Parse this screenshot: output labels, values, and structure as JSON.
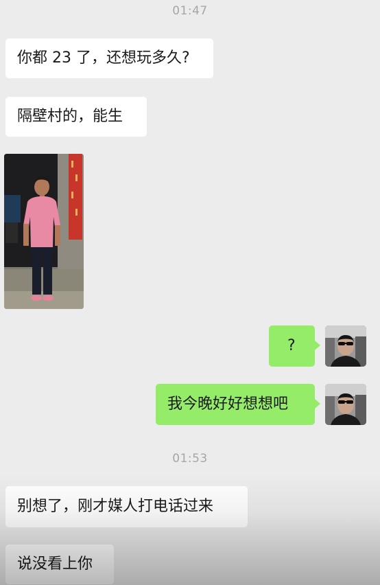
{
  "chat": {
    "timestamps": [
      "01:47",
      "01:53"
    ],
    "messages": {
      "m1": "你都 23 了，还想玩多久?",
      "m2": "隔壁村的，能生",
      "m4": "?",
      "m5": "我今晚好好想想吧",
      "m6": "别想了，刚才媒人打电话过来",
      "m7": "说没看上你"
    },
    "photo_icon": "photo-of-woman-in-pink-shirt",
    "avatar_icon": "man-with-sunglasses-avatar"
  },
  "colors": {
    "background": "#ececec",
    "incoming_bubble": "#ffffff",
    "outgoing_bubble": "#95ec69",
    "timestamp": "#a6a6a6"
  }
}
